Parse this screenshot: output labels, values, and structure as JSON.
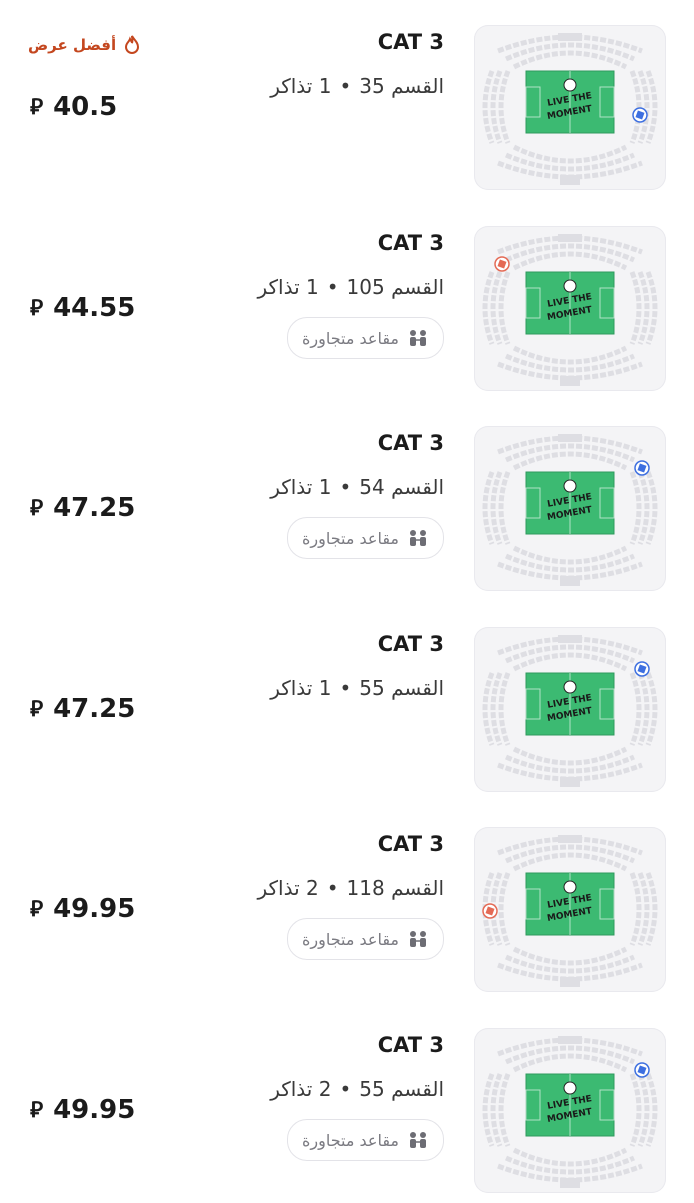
{
  "currency_symbol": "⃁",
  "adjacent_label": "مقاعد متجاورة",
  "best_offer_label": "أفضل عرض",
  "listings": [
    {
      "category": "CAT 3",
      "section": "القسم 35",
      "tickets": "1 تذاكر",
      "price": "40.5",
      "best_offer": true,
      "adjacent": false,
      "marker": "blue",
      "marker_side": "right"
    },
    {
      "category": "CAT 3",
      "section": "القسم 105",
      "tickets": "1 تذاكر",
      "price": "44.55",
      "best_offer": false,
      "adjacent": true,
      "marker": "red",
      "marker_side": "left-top"
    },
    {
      "category": "CAT 3",
      "section": "القسم 54",
      "tickets": "1 تذاكر",
      "price": "47.25",
      "best_offer": false,
      "adjacent": true,
      "marker": "blue",
      "marker_side": "right-top"
    },
    {
      "category": "CAT 3",
      "section": "القسم 55",
      "tickets": "1 تذاكر",
      "price": "47.25",
      "best_offer": false,
      "adjacent": false,
      "marker": "blue",
      "marker_side": "right-top"
    },
    {
      "category": "CAT 3",
      "section": "القسم 118",
      "tickets": "2 تذاكر",
      "price": "49.95",
      "best_offer": false,
      "adjacent": true,
      "marker": "red",
      "marker_side": "left"
    },
    {
      "category": "CAT 3",
      "section": "القسم 55",
      "tickets": "2 تذاكر",
      "price": "49.95",
      "best_offer": false,
      "adjacent": true,
      "marker": "blue",
      "marker_side": "right-top"
    }
  ],
  "map_caption_line1": "LIVE THE",
  "map_caption_line2": "MOMENT",
  "colors": {
    "marker_blue": "#3d6fe0",
    "marker_red": "#e46a55",
    "pitch": "#3cba72",
    "best_offer": "#c4471f"
  }
}
